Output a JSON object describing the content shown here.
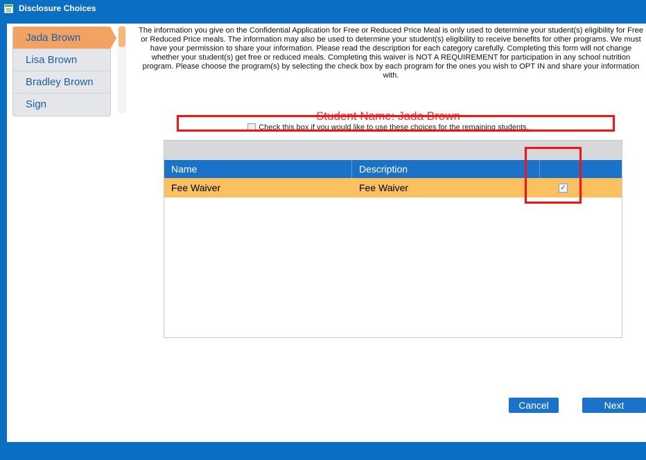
{
  "window": {
    "title": "Disclosure Choices"
  },
  "sidebar": {
    "items": [
      {
        "label": "Jada Brown",
        "active": true
      },
      {
        "label": "Lisa Brown",
        "active": false
      },
      {
        "label": "Bradley Brown",
        "active": false
      },
      {
        "label": "Sign",
        "active": false
      }
    ]
  },
  "info_text": "The information you give on the Confidential Application for Free or Reduced Price Meal is only used to determine your student(s) eligibility for Free or Reduced Price meals. The information may also be used to determine your student(s) eligibility to receive benefits for other programs. We must have your permission to share your information. Please read the description for each category carefully. Completing this form will not change whether your student(s) get free or reduced meals. Completing this waiver is NOT A REQUIREMENT for participation in any school nutrition program. Please choose the program(s) by selecting the check box by each program for the ones you wish to OPT IN and share your information with.",
  "student_name": "Student Name: Jada Brown",
  "apply_all": {
    "label": "Check this box if you would like to use these choices for the remaining students.",
    "checked": false
  },
  "grid": {
    "columns": [
      "Name",
      "Description",
      ""
    ],
    "rows": [
      {
        "name": "Fee Waiver",
        "description": "Fee Waiver",
        "checked": true
      }
    ]
  },
  "buttons": {
    "cancel": "Cancel",
    "next": "Next"
  },
  "colors": {
    "header_blue": "#0a6fc2",
    "selected_row": "#fbc060",
    "annotation_red": "#ff1010"
  }
}
